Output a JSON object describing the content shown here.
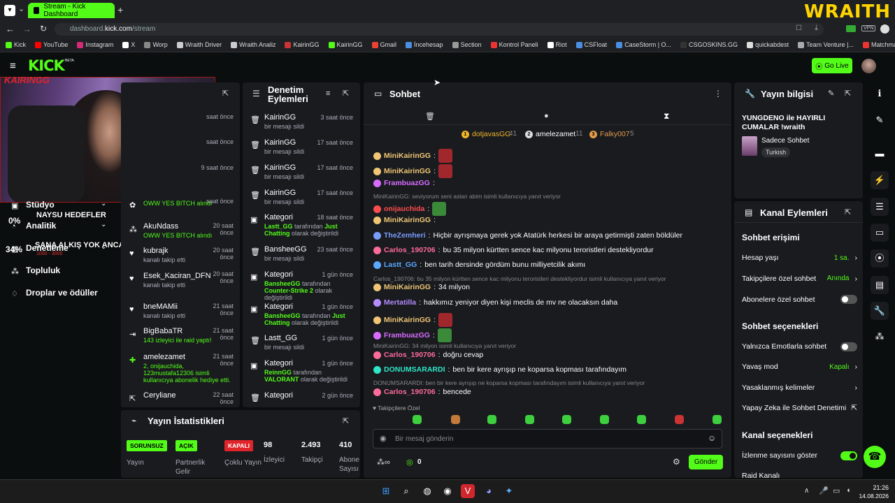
{
  "browser": {
    "tab_title": "Stream - Kick Dashboard",
    "url_prefix": "dashboard.",
    "url_domain": "kick.com",
    "url_path": "/stream",
    "overlay_brand": "WRAITH",
    "bookmarks": [
      "Kick",
      "YouTube",
      "Instagram",
      "X",
      "Worp",
      "Wraith Driver",
      "Wraith Analiz",
      "KairinGG",
      "KairinGG",
      "Gmail",
      "İncehesap",
      "Section",
      "Kontrol Paneli",
      "Riot",
      "CSFloat",
      "CaseStorm | O...",
      "CSGOSKINS.GG",
      "quickabdest",
      "Team Venture |...",
      "Matchmaking"
    ],
    "bookmark_colors": [
      "#53fc18",
      "#ff0000",
      "#d62976",
      "#ffffff",
      "#888888",
      "#cccccc",
      "#cccccc",
      "#c33",
      "#53fc18",
      "#ea4335",
      "#4a90e2",
      "#999999",
      "#e33",
      "#fff",
      "#4a90e2",
      "#4a90e2",
      "#333",
      "#ddd",
      "#aaa",
      "#e33"
    ]
  },
  "header": {
    "logo": "KICK",
    "logo_badge": "BETA",
    "go_live": "Go Live"
  },
  "overlay": {
    "stream_name": "KAIRINGG",
    "goal1_pct": "0%",
    "goal1_label": "NAYSU HEDEFLER",
    "goal2_pct": "34%",
    "goal2_label": "SANA ALKIŞ YOK ANCA KICK",
    "goal2_sub": "1000 - 3000"
  },
  "left_nav": {
    "items": [
      "Stüdyo",
      "Analitik",
      "Denetleme",
      "Topluluk",
      "Droplar ve ödüller"
    ]
  },
  "activity": {
    "rows": [
      {
        "title": "",
        "sub": "OWW YES BITCH alındı",
        "time": "saat önce"
      },
      {
        "title": "AkuNdass",
        "sub": "OWW YES BITCH alındı",
        "time": "20 saat önce"
      },
      {
        "title": "kubrajk",
        "sub": "kanalı takip etti",
        "time": "20 saat önce"
      },
      {
        "title": "Esek_Kaciran_DFN",
        "sub": "kanalı takip etti",
        "time": "20 saat önce"
      },
      {
        "title": "bneMAMii",
        "sub": "kanalı takip etti",
        "time": "21 saat önce"
      },
      {
        "title": "BigBabaTR",
        "sub": "143 izleyici ile raid yaptı!",
        "time": "21 saat önce"
      },
      {
        "title": "amelezamet",
        "sub": "2, onijauchida, 123mustafa12306 isimli kullanıcıya abonelik hediye etti.",
        "time": "21 saat önce"
      },
      {
        "title": "Ceryliane",
        "sub": "",
        "time": "22 saat önce"
      }
    ],
    "partial_times": [
      "saat önce",
      "saat önce",
      "9 saat önce"
    ]
  },
  "moderation": {
    "title": "Denetim Eylemleri",
    "rows": [
      {
        "title": "KairinGG",
        "sub": "bir mesajı sildi",
        "time": "3 saat önce"
      },
      {
        "title": "KairinGG",
        "sub": "bir mesajı sildi",
        "time": "17 saat önce"
      },
      {
        "title": "KairinGG",
        "sub": "bir mesajı sildi",
        "time": "17 saat önce"
      },
      {
        "title": "KairinGG",
        "sub": "bir mesajı sildi",
        "time": "17 saat önce"
      },
      {
        "title": "Kategori",
        "hl": "Lastt_GG",
        "mid": "tarafından",
        "hl2": "Just Chatting",
        "sub": "olarak değiştirildi",
        "time": "18 saat önce"
      },
      {
        "title": "BansheeGG",
        "sub": "bir mesajı sildi",
        "time": "23 saat önce"
      },
      {
        "title": "Kategori",
        "hl": "BansheeGG",
        "mid": "tarafından",
        "hl2": "Counter-Strike 2",
        "sub": "olarak değiştirildi",
        "time": "1 gün önce"
      },
      {
        "title": "Kategori",
        "hl": "BansheeGG",
        "mid": "tarafından",
        "hl2": "Just Chatting",
        "sub": "olarak değiştirildi",
        "time": "1 gün önce"
      },
      {
        "title": "Lastt_GG",
        "sub": "bir mesajı sildi",
        "time": "1 gün önce"
      },
      {
        "title": "Kategori",
        "hl": "ReinnGG",
        "mid": "tarafından",
        "hl2": "VALORANT",
        "sub": "olarak değiştirildi",
        "time": "1 gün önce"
      },
      {
        "title": "Kategori",
        "sub": "",
        "time": "2 gün önce"
      }
    ]
  },
  "stats": {
    "title": "Yayın İstatistikleri",
    "items": [
      {
        "badge": "SORUNSUZ",
        "label": "Yayın"
      },
      {
        "badge": "AÇIK",
        "label": "Partnerlik Gelir"
      },
      {
        "badge": "KAPALI",
        "label": "Çoklu Yayın"
      }
    ],
    "numbers": [
      {
        "value": "98",
        "label": "İzleyici"
      },
      {
        "value": "2.493",
        "label": "Takipçi"
      },
      {
        "value": "410",
        "label": "Abone Sayısı"
      }
    ]
  },
  "chat": {
    "title": "Sohbet",
    "leaders": [
      {
        "name": "dotjavasGG",
        "count": "41"
      },
      {
        "name": "amelezamet",
        "count": "11"
      },
      {
        "name": "Falky007",
        "count": "5"
      }
    ],
    "messages": [
      {
        "type": "msg",
        "user": "MiniKairinGG",
        "color": "#f0c674",
        "text": "",
        "emote": true
      },
      {
        "type": "msg",
        "user": "MiniKairinGG",
        "color": "#f0c674",
        "text": "",
        "emote": true
      },
      {
        "type": "msg",
        "user": "FrambuazGG",
        "color": "#d86cff",
        "text": ""
      },
      {
        "type": "reply",
        "text": "MiniKairinGG: seviyorum seni aslan abim isimli kullanıcıya yanıt veriyor"
      },
      {
        "type": "msg",
        "user": "onijauchida",
        "color": "#ff4d4d",
        "text": "",
        "emote": true
      },
      {
        "type": "msg",
        "user": "MiniKairinGG",
        "color": "#f0c674",
        "text": ""
      },
      {
        "type": "msg",
        "user": "TheZemheri",
        "color": "#7b9cff",
        "text": "Hiçbir ayrışmaya gerek yok Atatürk herkesi bir araya getirmişti zaten böldüler"
      },
      {
        "type": "msg",
        "user": "Carlos_190706",
        "color": "#ff6b9a",
        "text": "bu 35 milyon kürtten sence kac milyonu teroristleri destekliyordur"
      },
      {
        "type": "msg",
        "user": "Lastt_GG",
        "color": "#5aa8ff",
        "text": "ben tarih dersinde gördüm bunu milliyetcilik akımı"
      },
      {
        "type": "reply",
        "text": "Carlos_190706: bu 35 milyon kürtten sence kac milyonu teroristleri destekliyordur isimli kullanıcıya yanıt veriyor"
      },
      {
        "type": "msg",
        "user": "MiniKairinGG",
        "color": "#f0c674",
        "text": "34 milyon"
      },
      {
        "type": "msg",
        "user": "Mertatilla",
        "color": "#b48cff",
        "text": "hakkımız yeniyor diyen kişi meclis de mv ne olacaksın daha"
      },
      {
        "type": "msg",
        "user": "MiniKairinGG",
        "color": "#f0c674",
        "text": "",
        "emote": true
      },
      {
        "type": "msg",
        "user": "FrambuazGG",
        "color": "#d86cff",
        "text": "",
        "emote": true
      },
      {
        "type": "reply",
        "text": "MiniKairinGG: 34 milyon isimli kullanıcıya yanıt veriyor"
      },
      {
        "type": "msg",
        "user": "Carlos_190706",
        "color": "#ff6b9a",
        "text": "doğru cevap"
      },
      {
        "type": "msg",
        "user": "DONUMSARARDI",
        "color": "#2ee6c8",
        "text": "ben bir kere ayrışıp ne koparsa kopması tarafındayım"
      },
      {
        "type": "reply",
        "text": "DONUMSARARDI: ben bir kere ayrışıp ne koparsa kopması tarafındayım isimli kullanıcıya yanıt veriyor"
      },
      {
        "type": "msg",
        "user": "Carlos_190706",
        "color": "#ff6b9a",
        "text": "bencede"
      }
    ],
    "followers_only": "Takipçilere Özel",
    "input_placeholder": "Bir mesaj gönderin",
    "points": "0",
    "send": "Gönder"
  },
  "stream_info": {
    "title": "Yayın bilgisi",
    "stream_title": "YUNGDENO ile HAYIRLI CUMALAR !wraith",
    "category": "Sadece Sohbet",
    "tag": "Turkish"
  },
  "channel_actions": {
    "title": "Kanal Eylemleri",
    "sections": [
      {
        "heading": "Sohbet erişimi",
        "rows": [
          {
            "label": "Hesap yaşı",
            "value": "1 sa.",
            "kind": "link"
          },
          {
            "label": "Takipçilere özel sohbet",
            "value": "Anında",
            "kind": "link"
          },
          {
            "label": "Abonelere özel sohbet",
            "value": "",
            "kind": "toggle-off"
          }
        ]
      },
      {
        "heading": "Sohbet seçenekleri",
        "rows": [
          {
            "label": "Yalnızca Emotlarla sohbet",
            "value": "",
            "kind": "toggle-off"
          },
          {
            "label": "Yavaş mod",
            "value": "Kapalı",
            "kind": "link"
          },
          {
            "label": "Yasaklanmış kelimeler",
            "value": "",
            "kind": "link"
          },
          {
            "label": "Yapay Zeka ile Sohbet Denetimi",
            "value": "",
            "kind": "external"
          }
        ]
      },
      {
        "heading": "Kanal seçenekleri",
        "rows": [
          {
            "label": "İzlenme sayısını göster",
            "value": "",
            "kind": "toggle-on"
          },
          {
            "label": "Raid Kanalı",
            "value": "",
            "kind": "none"
          }
        ]
      }
    ]
  },
  "taskbar": {
    "time": "21:26",
    "date": "14.08.2026"
  }
}
